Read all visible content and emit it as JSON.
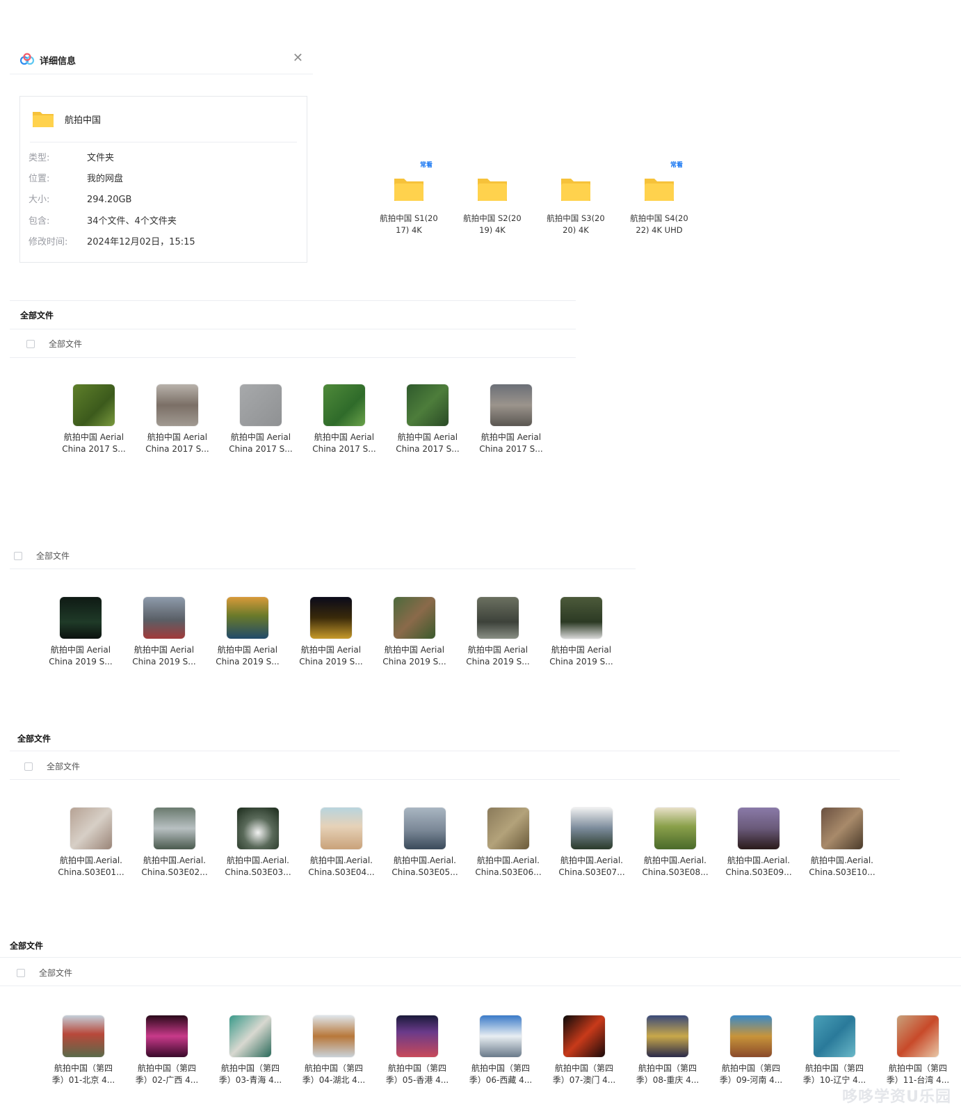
{
  "details": {
    "title": "详细信息",
    "close": "✕",
    "folder_name": "航拍中国",
    "rows": [
      {
        "label": "类型:",
        "value": "文件夹"
      },
      {
        "label": "位置:",
        "value": "我的网盘"
      },
      {
        "label": "大小:",
        "value": "294.20GB"
      },
      {
        "label": "包含:",
        "value": "34个文件、4个文件夹"
      },
      {
        "label": "修改时间:",
        "value": "2024年12月02日，15:15"
      }
    ]
  },
  "folders": [
    {
      "line1": "航拍中国 S1(20",
      "line2": "17) 4K",
      "badge": "常看"
    },
    {
      "line1": "航拍中国 S2(20",
      "line2": "19) 4K",
      "badge": ""
    },
    {
      "line1": "航拍中国 S3(20",
      "line2": "20) 4K",
      "badge": ""
    },
    {
      "line1": "航拍中国 S4(20",
      "line2": "22) 4K UHD",
      "badge": "常看"
    }
  ],
  "section_title": "全部文件",
  "select_all": "全部文件",
  "season1": [
    {
      "l1": "航拍中国 Aerial",
      "l2": "China 2017 S...",
      "c": "linear-gradient(135deg,#5e7f2a,#3c5a1c 60%,#7a9a3e)"
    },
    {
      "l1": "航拍中国 Aerial",
      "l2": "China 2017 S...",
      "c": "linear-gradient(180deg,#b8b2ab,#7b6f66 50%,#a19a92)"
    },
    {
      "l1": "航拍中国 Aerial",
      "l2": "China 2017 S...",
      "c": "linear-gradient(135deg,#a7a9ab,#8f9193)"
    },
    {
      "l1": "航拍中国 Aerial",
      "l2": "China 2017 S...",
      "c": "linear-gradient(135deg,#4f8a3a,#2f6b2a 60%,#6aa24a)"
    },
    {
      "l1": "航拍中国 Aerial",
      "l2": "China 2017 S...",
      "c": "linear-gradient(135deg,#2f5a2c,#4d7d3b 50%,#2a4a26)"
    },
    {
      "l1": "航拍中国 Aerial",
      "l2": "China 2017 S...",
      "c": "linear-gradient(180deg,#6b6f77,#9b948c 50%,#5a5651)"
    }
  ],
  "season2": [
    {
      "l1": "航拍中国 Aerial",
      "l2": "China 2019 S...",
      "c": "linear-gradient(180deg,#0f1a14,#1f3a28 60%,#0b120e)"
    },
    {
      "l1": "航拍中国 Aerial",
      "l2": "China 2019 S...",
      "c": "linear-gradient(180deg,#8e9bab,#5a5f66 55%,#a13a3a)"
    },
    {
      "l1": "航拍中国 Aerial",
      "l2": "China 2019 S...",
      "c": "linear-gradient(180deg,#d89a3a,#6a7a2a 45%,#214a6a)"
    },
    {
      "l1": "航拍中国 Aerial",
      "l2": "China 2019 S...",
      "c": "linear-gradient(180deg,#0a0a1a,#3a2a0a 50%,#c79a2a)"
    },
    {
      "l1": "航拍中国 Aerial",
      "l2": "China 2019 S...",
      "c": "linear-gradient(135deg,#4c6a3c,#8a6a4a 50%,#3a5a2c)"
    },
    {
      "l1": "航拍中国 Aerial",
      "l2": "China 2019 S...",
      "c": "linear-gradient(180deg,#6b7060,#3d423a 60%,#8a8f85)"
    },
    {
      "l1": "航拍中国 Aerial",
      "l2": "China 2019 S...",
      "c": "linear-gradient(180deg,#4c5a3a,#2c3a24 60%,#d8d8d8)"
    }
  ],
  "season3": [
    {
      "l1": "航拍中国.Aerial.",
      "l2": "China.S03E01...",
      "c": "linear-gradient(135deg,#b6a294,#d7cfc6 50%,#9a8477)"
    },
    {
      "l1": "航拍中国.Aerial.",
      "l2": "China.S03E02...",
      "c": "linear-gradient(180deg,#6a7a6e,#b8c0c2 50%,#4a5a4e)"
    },
    {
      "l1": "航拍中国.Aerial.",
      "l2": "China.S03E03...",
      "c": "radial-gradient(circle at 50% 60%,#f2f2f2,#5a6a5a 45%,#1a2a1a)"
    },
    {
      "l1": "航拍中国.Aerial.",
      "l2": "China.S03E04...",
      "c": "linear-gradient(180deg,#b8d4de,#e6d2b8 45%,#c9a27a)"
    },
    {
      "l1": "航拍中国.Aerial.",
      "l2": "China.S03E05...",
      "c": "linear-gradient(180deg,#a9b6c2,#7a8796 55%,#3a4a5a)"
    },
    {
      "l1": "航拍中国.Aerial.",
      "l2": "China.S03E06...",
      "c": "linear-gradient(135deg,#8a7a5a,#b3a27a 50%,#6a5a3a)"
    },
    {
      "l1": "航拍中国.Aerial.",
      "l2": "China.S03E07...",
      "c": "linear-gradient(180deg,#f0f0f0,#7a8a9a 50%,#2a3a2a)"
    },
    {
      "l1": "航拍中国.Aerial.",
      "l2": "China.S03E08...",
      "c": "linear-gradient(180deg,#e8e0c8,#8aa04a 45%,#4a6a2a)"
    },
    {
      "l1": "航拍中国.Aerial.",
      "l2": "China.S03E09...",
      "c": "linear-gradient(180deg,#8a7aa8,#6a5a7a 50%,#2a1a1a)"
    },
    {
      "l1": "航拍中国.Aerial.",
      "l2": "China.S03E10...",
      "c": "linear-gradient(135deg,#6a5040,#a88a6a 50%,#4a3a2a)"
    }
  ],
  "season4": [
    {
      "l1": "航拍中国（第四",
      "l2": "季）01-北京 4...",
      "c": "linear-gradient(180deg,#c4d0da,#b8483a 45%,#5a6a4a)"
    },
    {
      "l1": "航拍中国（第四",
      "l2": "季）02-广西 4...",
      "c": "linear-gradient(180deg,#2a0a1a,#c83a8a 50%,#3a0a2a)"
    },
    {
      "l1": "航拍中国（第四",
      "l2": "季）03-青海 4...",
      "c": "linear-gradient(135deg,#3a9a8a,#d8d8d0 50%,#2a6a5a)"
    },
    {
      "l1": "航拍中国（第四",
      "l2": "季）04-湖北 4...",
      "c": "linear-gradient(180deg,#dfe6ec,#b8783a 50%,#c9d2d8)"
    },
    {
      "l1": "航拍中国（第四",
      "l2": "季）05-香港 4...",
      "c": "linear-gradient(180deg,#1a1a3a,#6a3a8a 40%,#c84a5a)"
    },
    {
      "l1": "航拍中国（第四",
      "l2": "季）06-西藏 4...",
      "c": "linear-gradient(180deg,#3a7ac8,#e8eef2 50%,#6a7a8a)"
    },
    {
      "l1": "航拍中国（第四",
      "l2": "季）07-澳门 4...",
      "c": "linear-gradient(135deg,#0a0a0a,#c83a1a 50%,#1a0a0a)"
    },
    {
      "l1": "航拍中国（第四",
      "l2": "季）08-重庆 4...",
      "c": "linear-gradient(180deg,#3a4a7a,#c8a84a 50%,#2a2a4a)"
    },
    {
      "l1": "航拍中国（第四",
      "l2": "季）09-河南 4...",
      "c": "linear-gradient(180deg,#3a8ac8,#c8943a 50%,#8a4a2a)"
    },
    {
      "l1": "航拍中国（第四",
      "l2": "季）10-辽宁 4...",
      "c": "linear-gradient(135deg,#4aa0b8,#2a7a9a 50%,#6ab8c8)"
    },
    {
      "l1": "航拍中国（第四",
      "l2": "季）11-台湾 4...",
      "c": "linear-gradient(135deg,#c8a07a,#c84a2a 50%,#e8c8a8)"
    }
  ],
  "watermark": "哆哆学资U乐园"
}
